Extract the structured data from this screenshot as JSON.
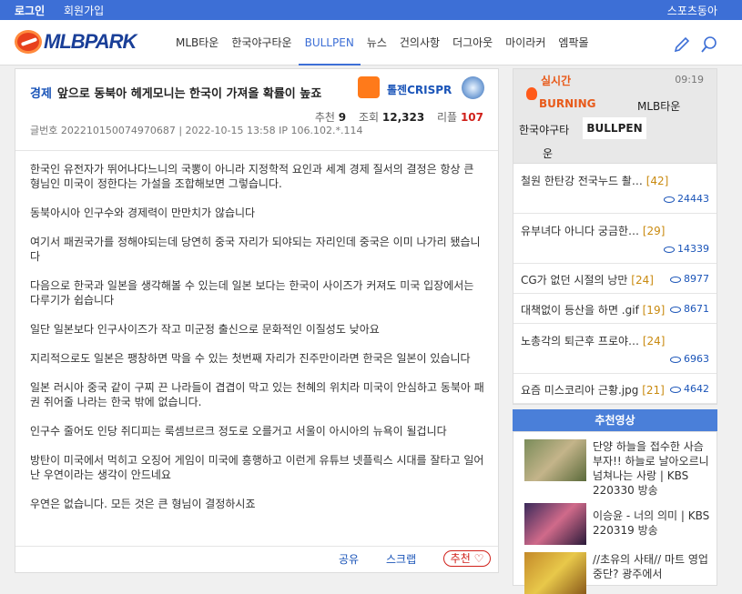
{
  "topbar": {
    "login": "로그인",
    "join": "회원가입",
    "sports": "스포츠동아"
  },
  "logo": "MLBPARK",
  "nav": [
    "MLB타운",
    "한국야구타운",
    "BULLPEN",
    "뉴스",
    "건의사항",
    "더그아웃",
    "마이라커",
    "엠팍몰"
  ],
  "nav_active": 2,
  "article": {
    "category": "경제",
    "title": "앞으로 동북아 헤게모니는 한국이 가져올 확률이 높죠",
    "author": "톨젠CRISPR",
    "labels": {
      "rec": "추천",
      "views": "조회",
      "reply": "리플"
    },
    "rec": "9",
    "views": "12,323",
    "replies": "107",
    "meta": "글번호 202210150074970687 | 2022-10-15 13:58    IP 106.102.*.114",
    "body": [
      "한국인 유전자가 뛰어나다느니의 국뽕이 아니라 지정학적 요인과 세계 경제 질서의 결정은 항상 큰 형님인 미국이 정한다는 가설을 조합해보면 그렇습니다.",
      "동북아시아 인구수와 경제력이 만만치가 않습니다",
      "여기서 패권국가를 정해야되는데 당연히 중국 자리가 되야되는 자리인데 중국은 이미 나가리 됐습니다",
      "다음으로 한국과 일본을 생각해볼 수 있는데 일본 보다는 한국이 사이즈가 커져도 미국 입장에서는 다루기가 쉽습니다",
      "일단 일본보다 인구사이즈가 작고 미군정 출신으로 문화적인 이질성도 낮아요",
      "지리적으로도 일본은 팽창하면 막을 수 있는 첫번째 자리가 진주만이라면 한국은 일본이 있습니다",
      "일본 러시아 중국 같이 구찌 끈 나라들이 겹겹이 막고 있는 천혜의 위치라 미국이 안심하고 동북아 패권 쥐어줄 나라는 한국 밖에 없습니다.",
      "인구수 줄어도 인당 쥐디피는 룩셈브르크 정도로 오를거고 서울이 아시아의 뉴욕이 될겁니다",
      "방탄이 미국에서 먹히고 오징어 게임이 미국에 흥행하고 이런게 유튜브 넷플릭스 시대를 잘타고 일어난 우연이라는 생각이 안드네요",
      "우연은 없습니다. 모든 것은 큰 형님이 결정하시죠"
    ],
    "share": "공유",
    "scrap": "스크랩",
    "recommend": "추천 ♡"
  },
  "realtime": {
    "live": "실시간",
    "time": "09:19",
    "burning": "BURNING",
    "tabs": [
      "MLB타운",
      "한국야구타",
      "BULLPEN",
      "운"
    ]
  },
  "hot": [
    {
      "title": "철원 한탄강 전국누드 촬…",
      "comments": "[42]",
      "views": "24443"
    },
    {
      "title": "유부녀다 아니다 궁금한…",
      "comments": "[29]",
      "views": "14339"
    },
    {
      "title": "CG가 없던 시절의 낭만",
      "comments": "[24]",
      "views": "8977"
    },
    {
      "title": "대책없이 등산을 하면 .gif",
      "comments": "[19]",
      "views": "8671"
    },
    {
      "title": "노총각의 퇴근후 프로야…",
      "comments": "[24]",
      "views": "6963"
    },
    {
      "title": "요즘 미스코리아 근황.jpg",
      "comments": "[21]",
      "views": "4642"
    }
  ],
  "videos": {
    "header": "추천영상",
    "items": [
      {
        "title": "단양 하늘을 접수한 사슴 부자!! 하늘로 날아오르니 넘쳐나는 사랑 | KBS 220330 방송"
      },
      {
        "title": "이승윤 - 너의 의미 | KBS 220319 방송"
      },
      {
        "title": "//초유의 사태// 마트 영업 중단? 광주에서"
      }
    ]
  }
}
